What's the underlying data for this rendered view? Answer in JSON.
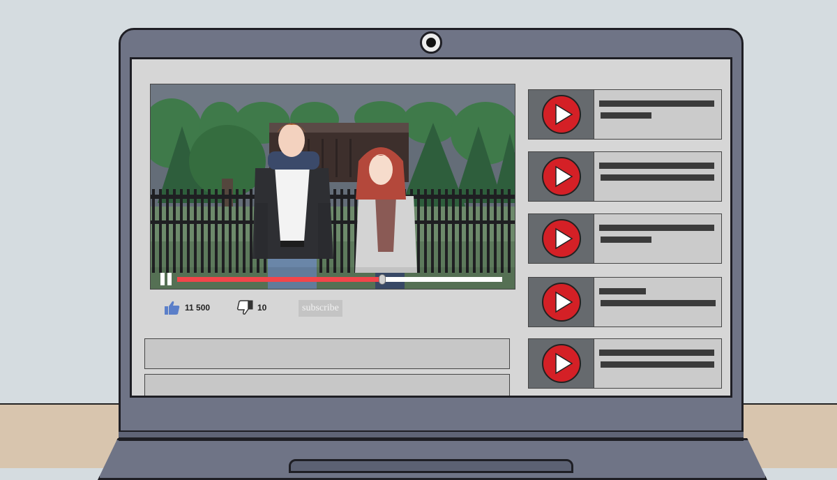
{
  "video": {
    "likes": "11 500",
    "dislikes": "10",
    "subscribe_label": "subscribe",
    "progress": 0.63
  },
  "colors": {
    "progress": "#f2454a",
    "play_icon": "#d42026",
    "screen": "#d6d6d6",
    "laptop": "#6f7486",
    "like_icon": "#5b7fc9"
  },
  "icons": {
    "pause": "pause-icon",
    "like": "thumbs-up-icon",
    "dislike": "thumbs-down-icon",
    "play": "play-icon",
    "webcam": "webcam-icon"
  },
  "recommendations_count": 5
}
